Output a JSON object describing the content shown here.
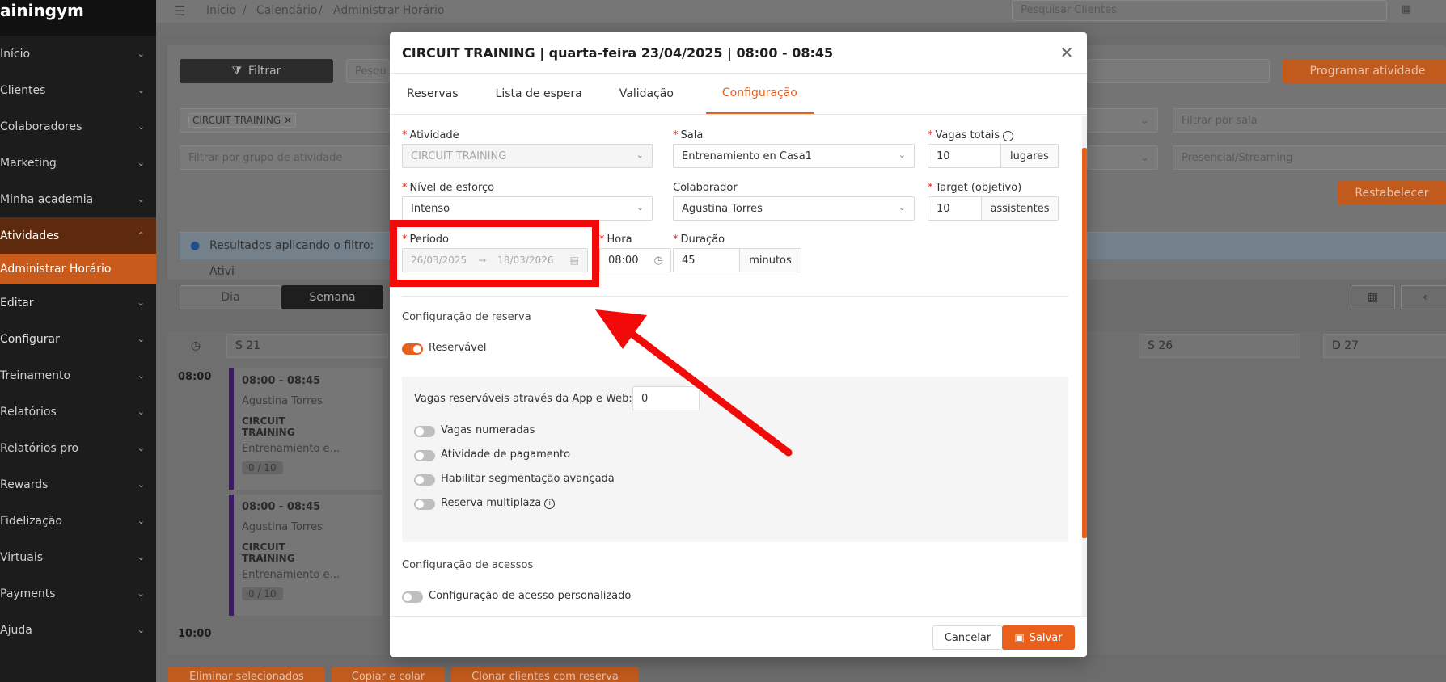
{
  "sidebar": {
    "brand": "ainingym",
    "items": [
      {
        "label": "Início"
      },
      {
        "label": "Clientes"
      },
      {
        "label": "Colaboradores"
      },
      {
        "label": "Marketing"
      },
      {
        "label": "Minha academia"
      },
      {
        "label": "Atividades"
      },
      {
        "label": "Administrar Horário"
      },
      {
        "label": "Editar"
      },
      {
        "label": "Configurar"
      },
      {
        "label": "Treinamento"
      },
      {
        "label": "Relatórios"
      },
      {
        "label": "Relatórios pro"
      },
      {
        "label": "Rewards"
      },
      {
        "label": "Fidelização"
      },
      {
        "label": "Virtuais"
      },
      {
        "label": "Payments"
      },
      {
        "label": "Ajuda"
      }
    ]
  },
  "topbar": {
    "breadcrumb": [
      "Início",
      "Calendário",
      "Administrar Horário"
    ],
    "search_placeholder": "Pesquisar Clientes"
  },
  "background": {
    "filter_button": "Filtrar",
    "search_placeholder": "Pesqu",
    "program_button": "Programar atividade",
    "activity_tag": "CIRCUIT TRAINING",
    "room_filter_placeholder": "Filtrar por sala",
    "group_filter_placeholder": "Filtrar por grupo de atividade",
    "mode_filter": "Presencial/Streaming",
    "reset_button": "Restabelecer",
    "info_text": "Resultados aplicando o filtro: Ativi",
    "view_day": "Dia",
    "view_week": "Semana",
    "days": [
      "S 21",
      "S 26",
      "D 27"
    ],
    "time_0800": "08:00",
    "time_1000": "10:00",
    "events": [
      {
        "time": "08:00 - 08:45",
        "instructor": "Agustina Torres",
        "title": "CIRCUIT TRAINING",
        "room": "Entrenamiento e...",
        "count": "0 / 10"
      },
      {
        "time": "08:00 - 08:45",
        "instructor": "Agustina Torres",
        "title": "CIRCUIT TRAINING",
        "room": "Entrenamiento e...",
        "count": "0 / 10"
      }
    ],
    "bottom_buttons": [
      "Eliminar selecionados",
      "Copiar e colar",
      "Clonar clientes com reserva"
    ]
  },
  "modal": {
    "title": "CIRCUIT TRAINING | quarta-feira 23/04/2025 | 08:00 - 08:45",
    "tabs": [
      "Reservas",
      "Lista de espera",
      "Validação",
      "Configuração"
    ],
    "active_tab": "Configuração",
    "fields": {
      "activity": {
        "label": "Atividade",
        "value": "CIRCUIT TRAINING"
      },
      "room": {
        "label": "Sala",
        "value": "Entrenamiento en Casa1"
      },
      "total_spots": {
        "label": "Vagas totais",
        "value": "10",
        "unit": "lugares"
      },
      "effort": {
        "label": "Nível de esforço",
        "value": "Intenso"
      },
      "collaborator": {
        "label": "Colaborador",
        "value": "Agustina Torres"
      },
      "target": {
        "label": "Target (objetivo)",
        "value": "10",
        "unit": "assistentes"
      },
      "period": {
        "label": "Período",
        "start": "26/03/2025",
        "end": "18/03/2026"
      },
      "hour": {
        "label": "Hora",
        "value": "08:00"
      },
      "duration": {
        "label": "Duração",
        "value": "45",
        "unit": "minutos"
      }
    },
    "reservation_section": "Configuração de reserva",
    "reservable_label": "Reservável",
    "app_web_label": "Vagas reserváveis através da App e Web",
    "app_web_value": "0",
    "options": [
      "Vagas numeradas",
      "Atividade de pagamento",
      "Habilitar segmentação avançada",
      "Reserva multiplaza"
    ],
    "access_section": "Configuração de acessos",
    "access_label": "Configuração de acesso personalizado",
    "cancel_label": "Cancelar",
    "save_label": "Salvar"
  },
  "colors": {
    "accent": "#e8601c",
    "annotation": "#f20a0a"
  }
}
